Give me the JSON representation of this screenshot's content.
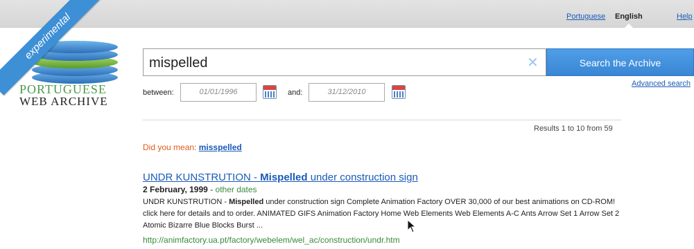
{
  "topbar": {
    "languages": [
      "Portuguese",
      "English"
    ],
    "current_language": "English",
    "help_label": "Help"
  },
  "logo": {
    "ribbon_text": "experimental",
    "line1": "PORTUGUESE",
    "line2": "WEB ARCHIVE"
  },
  "search": {
    "query": "mispelled",
    "clear_icon": "close-icon",
    "button_label": "Search the Archive",
    "advanced_label": "Advanced search",
    "between_label": "between:",
    "and_label": "and:",
    "date_from": "01/01/1996",
    "date_to": "31/12/2010",
    "accent_color": "#3d8fd6"
  },
  "results": {
    "count_text": "Results 1 to 10 from 59",
    "did_you_mean_label": "Did you mean:",
    "did_you_mean_term": "misspelled",
    "items": [
      {
        "title_prefix": "UNDR KUNSTRUTION - ",
        "title_bold": "Mispelled",
        "title_suffix": " under construction sign",
        "date": "2 February, 1999",
        "date_sep": " - ",
        "other_dates": "other dates",
        "snippet_prefix": "UNDR KUNSTRUTION - ",
        "snippet_bold": "Mispelled",
        "snippet_rest": " under construction sign Complete Animation Factory OVER 30,000 of our best animations on CD-ROM! click here for details and to order. ANIMATED GIFS Animation Factory Home Web Elements Web Elements A-C Ants Arrow Set 1 Arrow Set 2 Atomic Bizarre Blue Blocks Burst ...",
        "url": "http://animfactory.ua.pt/factory/webelem/wel_ac/construction/undr.htm"
      }
    ]
  }
}
